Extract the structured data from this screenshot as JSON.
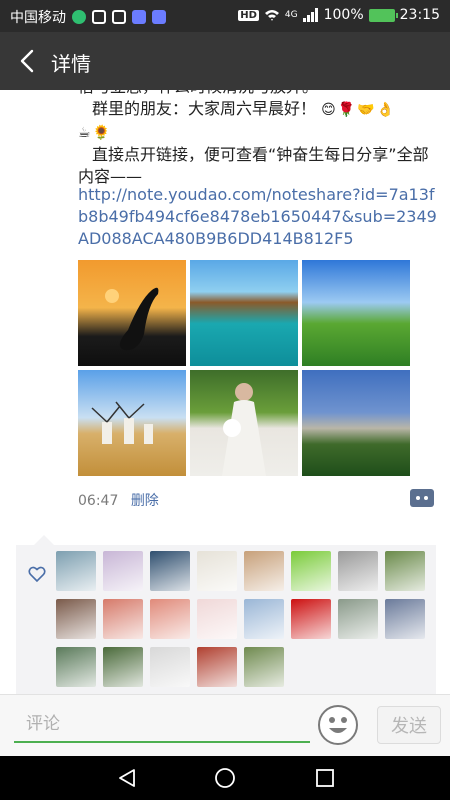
{
  "status_bar": {
    "carrier": "中国移动",
    "battery": "100%",
    "time": "23:15",
    "hd": "HD",
    "network": "4G"
  },
  "header": {
    "title": "详情"
  },
  "post": {
    "lines": [
      "借与立志，什么时候清洗与放弃。",
      "群里的朋友：大家周六早晨好！",
      "直接点开链接，便可查看“钟奋生每日分享”全部内容——"
    ],
    "emojis": [
      "😊",
      "🌹",
      "🤝",
      "👌",
      "☕",
      "🌻"
    ],
    "link": "http://note.youdao.com/noteshare?id=7a13fb8b49fb494cf6e8478eb1650447&sub=2349AD088ACA480B9B6DD414B812F5",
    "images": [
      "sunset-bird-photo",
      "turquoise-bay-photo",
      "green-hills-photo",
      "windmills-photo",
      "bride-in-lace-dress-photo",
      "palace-fountain-photo"
    ],
    "time": "06:47",
    "delete_label": "删除"
  },
  "likes": {
    "avatar_colors": [
      "#7d9fb0",
      "#c8b6d6",
      "#2f4f6f",
      "#e6e2d8",
      "#c7a07a",
      "#7acb3a",
      "#9a9a9a",
      "#6a8a4a",
      "#7a5a4a",
      "#d67a6a",
      "#e08a7a",
      "#f0d8d8",
      "#9ab6d6",
      "#cc1010",
      "#8a9a8a",
      "#6a7a9a",
      "#5a7a5a",
      "#4a6a3a",
      "#d8d8d8",
      "#b04030",
      "#6f8a4f"
    ]
  },
  "comment_bar": {
    "placeholder": "评论",
    "send_label": "发送"
  }
}
